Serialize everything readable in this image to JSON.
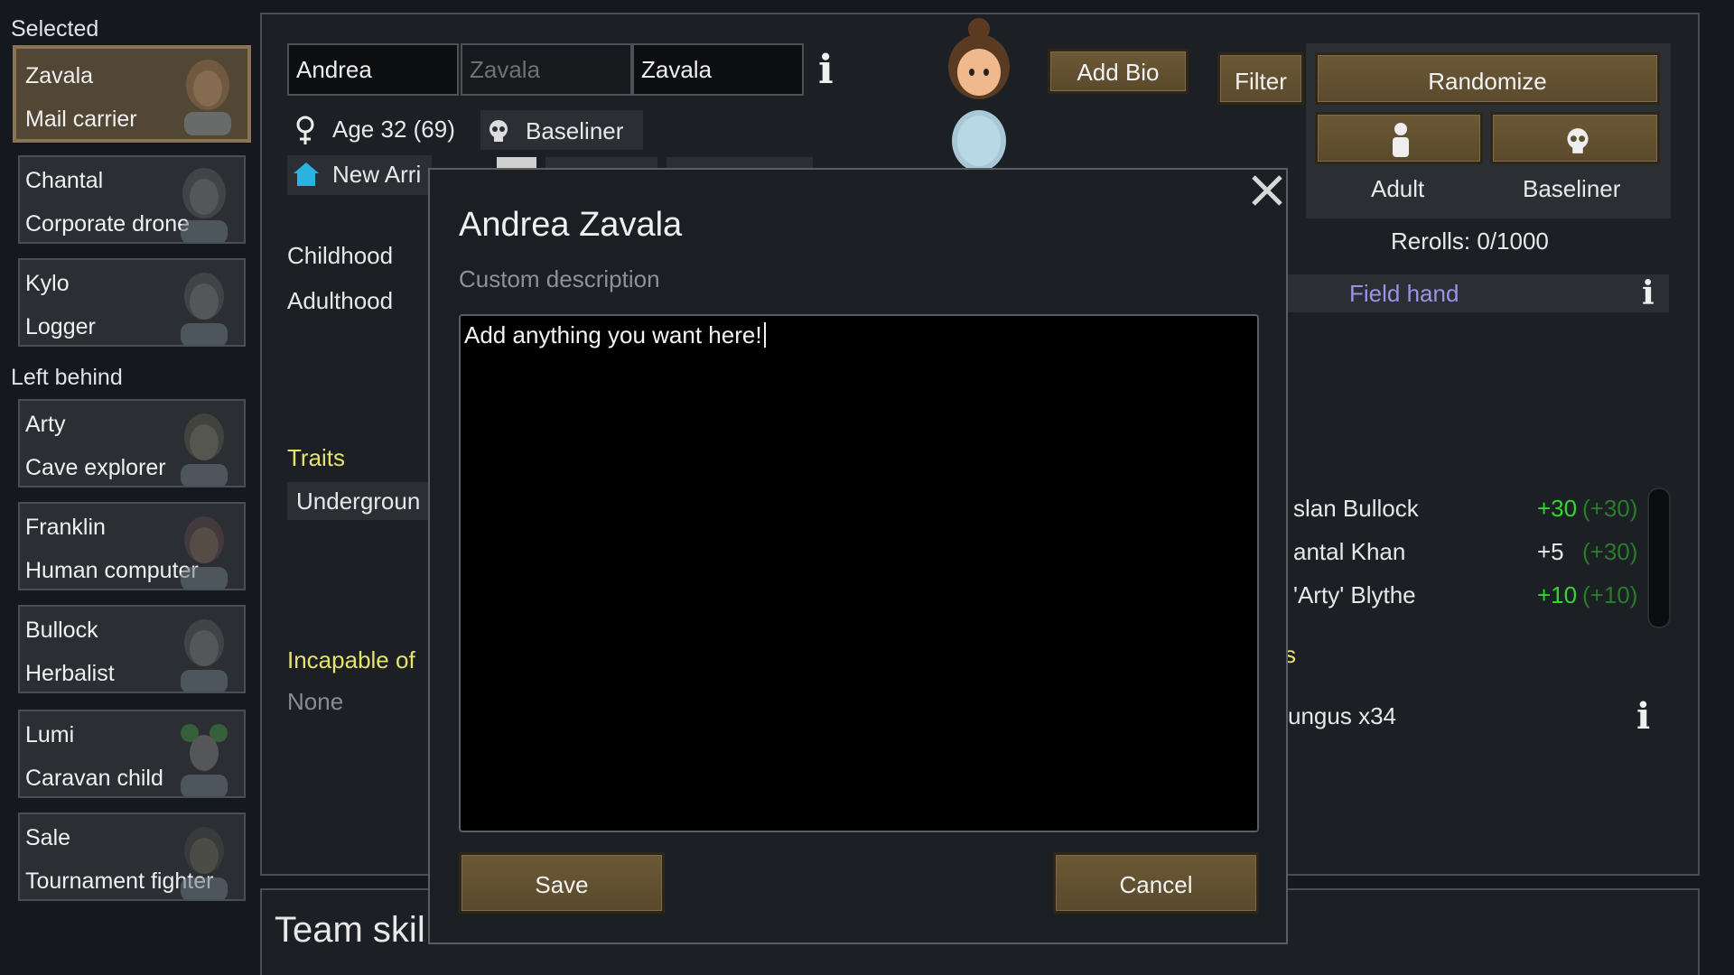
{
  "left": {
    "selected_label": "Selected",
    "left_behind_label": "Left behind",
    "selected": [
      {
        "name": "Zavala",
        "job": "Mail carrier"
      },
      {
        "name": "Chantal",
        "job": "Corporate drone"
      },
      {
        "name": "Kylo",
        "job": "Logger"
      }
    ],
    "left_behind": [
      {
        "name": "Arty",
        "job": "Cave explorer"
      },
      {
        "name": "Franklin",
        "job": "Human computer"
      },
      {
        "name": "Bullock",
        "job": "Herbalist"
      },
      {
        "name": "Lumi",
        "job": "Caravan child"
      },
      {
        "name": "Sale",
        "job": "Tournament fighter"
      }
    ]
  },
  "header": {
    "first_name": "Andrea",
    "nick_placeholder": "Zavala",
    "last_name": "Zavala",
    "age": "Age 32 (69)",
    "xenotype": "Baseliner",
    "faction_tag": "New Arri",
    "add_bio": "Add Bio",
    "filter": "Filter",
    "randomize": "Randomize",
    "lock_age_label": "Adult",
    "lock_xeno_label": "Baseliner",
    "rerolls": "Rerolls: 0/1000"
  },
  "backstory": {
    "childhood_label": "Childhood",
    "adulthood_label": "Adulthood",
    "adulthood_value": "Field hand"
  },
  "traits": {
    "label": "Traits",
    "items": [
      "Undergroun"
    ]
  },
  "incapable": {
    "label": "Incapable of",
    "value": "None"
  },
  "relations": [
    {
      "name": "slan Bullock",
      "value": "+30",
      "total": "(+30)",
      "green": true
    },
    {
      "name": "antal Khan",
      "value": "+5",
      "total": "(+30)",
      "green": false
    },
    {
      "name": "'Arty' Blythe",
      "value": "+10",
      "total": "(+10)",
      "green": true
    }
  ],
  "possessions": {
    "label_fragment": "s",
    "item": "ungus x34"
  },
  "team_skills_label": "Team skil",
  "modal": {
    "title": "Andrea Zavala",
    "subtitle": "Custom description",
    "text": "Add anything you want here!",
    "save": "Save",
    "cancel": "Cancel"
  },
  "colors": {
    "accent_gold": "#5f4f30",
    "trait_yellow": "#e6e36b",
    "backstory_purple": "#9b93e6",
    "opinion_green": "#35d435"
  }
}
